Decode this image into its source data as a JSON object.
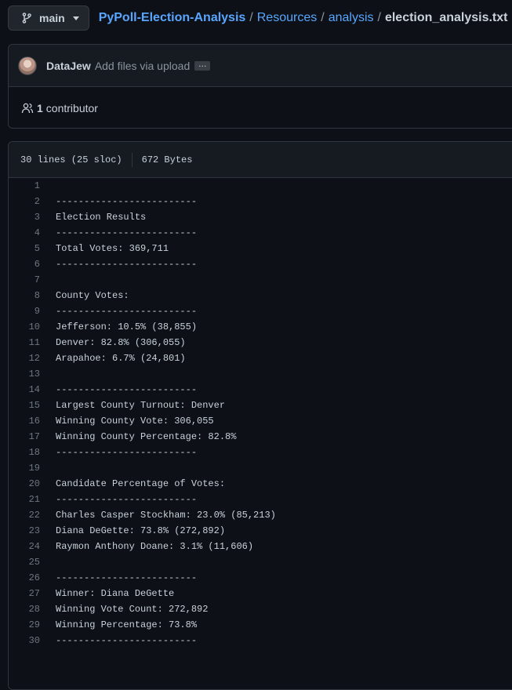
{
  "branch": {
    "name": "main"
  },
  "breadcrumb": {
    "repo": "PyPoll-Election-Analysis",
    "parts": [
      "Resources",
      "analysis"
    ],
    "file": "election_analysis.txt",
    "separator": "/"
  },
  "commit": {
    "author": "DataJew",
    "message": "Add files via upload",
    "ellipsis": "…"
  },
  "contributors": {
    "count": "1",
    "label": "contributor"
  },
  "file_info": {
    "lines": "30 lines (25 sloc)",
    "size": "672 Bytes"
  },
  "code_lines": [
    "",
    "-------------------------",
    "Election Results",
    "-------------------------",
    "Total Votes: 369,711",
    "-------------------------",
    "",
    "County Votes:",
    "-------------------------",
    "Jefferson: 10.5% (38,855)",
    "Denver: 82.8% (306,055)",
    "Arapahoe: 6.7% (24,801)",
    "",
    "-------------------------",
    "Largest County Turnout: Denver",
    "Winning County Vote: 306,055",
    "Winning County Percentage: 82.8%",
    "-------------------------",
    "",
    "Candidate Percentage of Votes:",
    "-------------------------",
    "Charles Casper Stockham: 23.0% (85,213)",
    "Diana DeGette: 73.8% (272,892)",
    "Raymon Anthony Doane: 3.1% (11,606)",
    "",
    "-------------------------",
    "Winner: Diana DeGette",
    "Winning Vote Count: 272,892",
    "Winning Percentage: 73.8%",
    "-------------------------"
  ]
}
